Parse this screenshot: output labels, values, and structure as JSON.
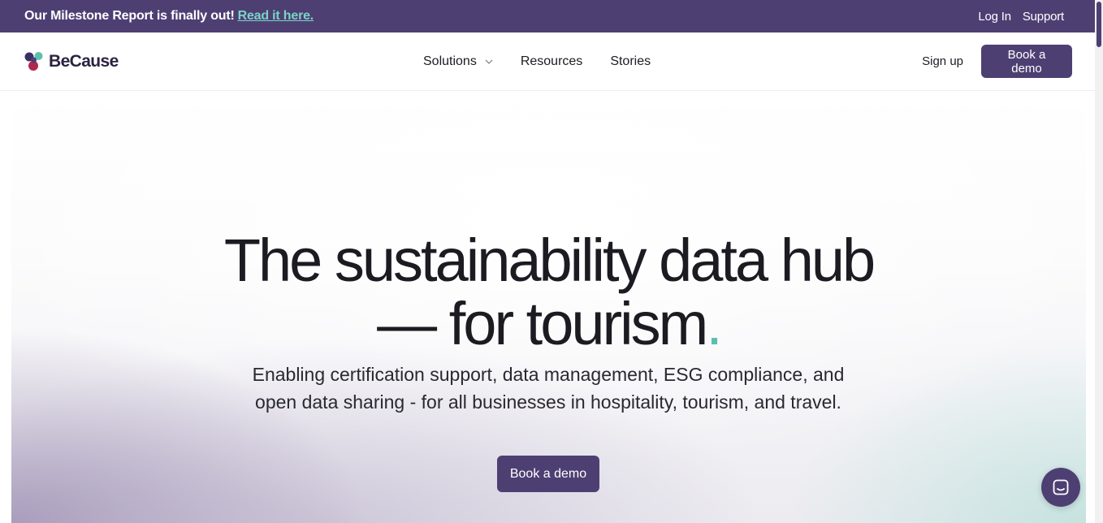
{
  "announcement": {
    "text": "Our Milestone Report is finally out!",
    "link": "Read it here.",
    "login": "Log In",
    "support": "Support"
  },
  "nav": {
    "brand": "BeCause",
    "items": [
      "Solutions",
      "Resources",
      "Stories"
    ],
    "signup": "Sign up",
    "cta": "Book a demo"
  },
  "hero": {
    "title_line1": "The sustainability data hub",
    "title_line2": "— for tourism",
    "title_dot": ".",
    "subtitle": "Enabling certification support, data management, ESG compliance, and open data sharing - for all businesses in hospitality, tourism, and travel.",
    "cta": "Book a demo"
  },
  "colors": {
    "brand": "#4e3f73",
    "accent": "#5bbfb0",
    "link": "#7ad4c6"
  },
  "icons": [
    "because-logo-icon",
    "chevron-down-icon",
    "chat-icon"
  ]
}
